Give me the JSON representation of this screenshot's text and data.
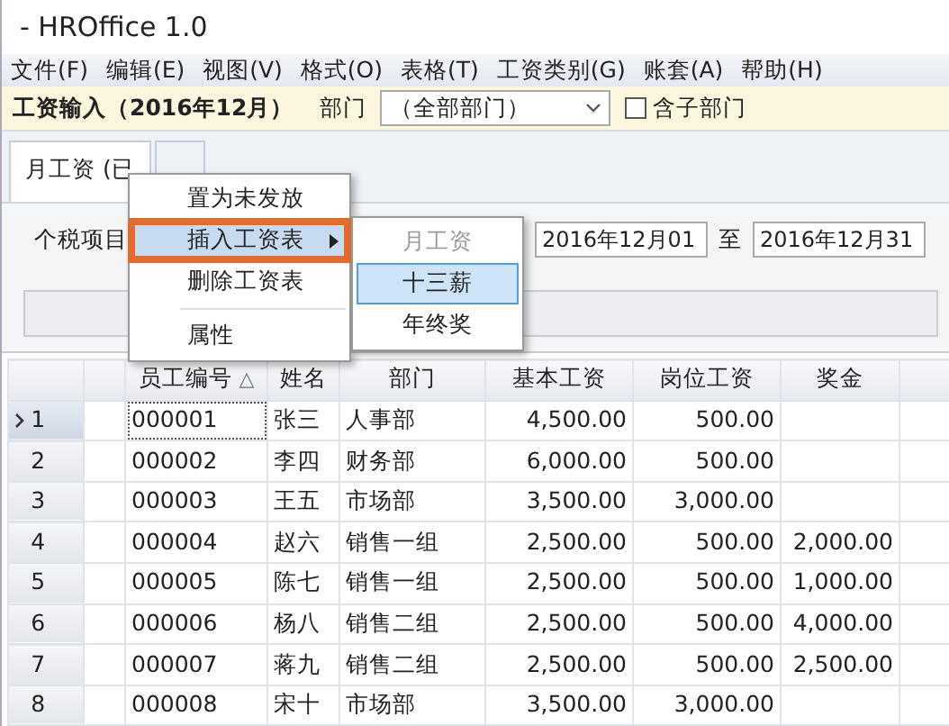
{
  "window": {
    "title": "- HROffice 1.0"
  },
  "menu_bar": [
    "文件(F)",
    "编辑(E)",
    "视图(V)",
    "格式(O)",
    "表格(T)",
    "工资类别(G)",
    "账套(A)",
    "帮助(H)"
  ],
  "toolbar": {
    "title": "工资输入（2016年12月）",
    "department_label": "部门",
    "department": "（全部部门）",
    "include_sub": {
      "label": "含子部门",
      "checked": false
    }
  },
  "tabs": [
    {
      "label": "月工资 (已",
      "selected": true
    },
    {
      "selected": false
    }
  ],
  "filter": {
    "label": "个税项目",
    "date_from": "2016年12月01",
    "to_label": "至",
    "date_to": "2016年12月31"
  },
  "context_menu": {
    "items": [
      {
        "kind": "item",
        "label": "置为未发放",
        "selected": false,
        "has_submenu": false
      },
      {
        "kind": "item",
        "label": "插入工资表",
        "selected": true,
        "has_submenu": true
      },
      {
        "kind": "item",
        "label": "删除工资表",
        "selected": false,
        "has_submenu": false
      },
      {
        "kind": "separator"
      },
      {
        "kind": "item",
        "label": "属性",
        "selected": false,
        "has_submenu": false
      }
    ]
  },
  "submenu": {
    "items": [
      {
        "label": "月工资",
        "disabled": true,
        "selected": false
      },
      {
        "label": "十三薪",
        "disabled": false,
        "selected": true
      },
      {
        "label": "年终奖",
        "disabled": false,
        "selected": false
      }
    ]
  },
  "table": {
    "columns": [
      {
        "label": "员工编号",
        "sort_indicator": "△"
      },
      {
        "label": "姓名"
      },
      {
        "label": "部门"
      },
      {
        "label": "基本工资"
      },
      {
        "label": "岗位工资"
      },
      {
        "label": "奖金"
      }
    ],
    "rows": [
      {
        "number": "1",
        "current": true,
        "cells": [
          "000001",
          "张三",
          "人事部",
          "4,500.00",
          "500.00"
        ]
      },
      {
        "number": "2",
        "current": false,
        "cells": [
          "000002",
          "李四",
          "财务部",
          "6,000.00",
          "500.00"
        ]
      },
      {
        "number": "3",
        "current": false,
        "cells": [
          "000003",
          "王五",
          "市场部",
          "3,500.00",
          "3,000.00"
        ]
      },
      {
        "number": "4",
        "current": false,
        "cells": [
          "000004",
          "赵六",
          "销售一组",
          "2,500.00",
          "500.00",
          "2,000.00"
        ]
      },
      {
        "number": "5",
        "current": false,
        "cells": [
          "000005",
          "陈七",
          "销售一组",
          "2,500.00",
          "500.00",
          "1,000.00"
        ]
      },
      {
        "number": "6",
        "current": false,
        "cells": [
          "000006",
          "杨八",
          "销售二组",
          "2,500.00",
          "500.00",
          "4,000.00"
        ]
      },
      {
        "number": "7",
        "current": false,
        "cells": [
          "000007",
          "蒋九",
          "销售二组",
          "2,500.00",
          "500.00",
          "2,500.00"
        ]
      },
      {
        "number": "8",
        "current": false,
        "cells": [
          "000008",
          "宋十",
          "市场部",
          "3,500.00",
          "3,000.00"
        ]
      }
    ]
  }
}
